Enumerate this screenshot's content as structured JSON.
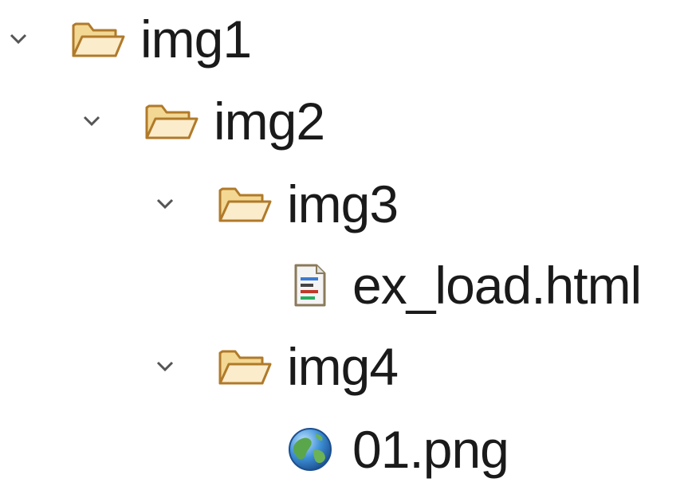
{
  "tree": {
    "nodes": [
      {
        "label": "img1",
        "icon": "folder-open-icon",
        "expanded": true
      },
      {
        "label": "img2",
        "icon": "folder-open-icon",
        "expanded": true
      },
      {
        "label": "img3",
        "icon": "folder-open-icon",
        "expanded": true
      },
      {
        "label": "ex_load.html",
        "icon": "html-file-icon"
      },
      {
        "label": "img4",
        "icon": "folder-open-icon",
        "expanded": true
      },
      {
        "label": "01.png",
        "icon": "globe-icon"
      }
    ]
  },
  "colors": {
    "folder_fill": "#f6e0a6",
    "folder_stroke": "#b07a2a",
    "chevron": "#555555",
    "text": "#1a1a1a"
  }
}
